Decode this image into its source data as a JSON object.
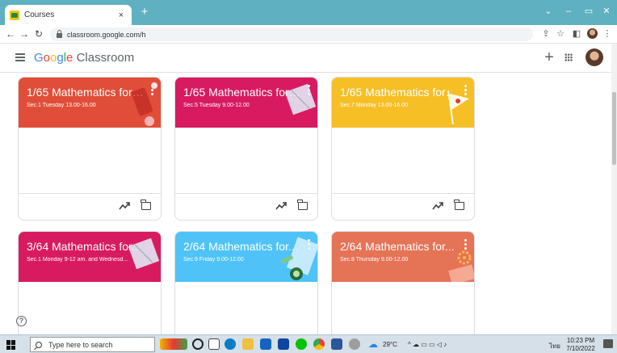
{
  "browser": {
    "tab_title": "Courses",
    "tab_close": "×",
    "new_tab": "+",
    "url": "classroom.google.com/h",
    "window_controls": [
      "⌄",
      "–",
      "▭",
      "✕"
    ]
  },
  "app": {
    "logo_letters": [
      "G",
      "o",
      "o",
      "g",
      "l",
      "e"
    ],
    "logo_product": "Classroom",
    "add_label": "+"
  },
  "courses": [
    {
      "title": "1/65 Mathematics for ...",
      "section": "Sec.1 Tuesday 13.00-16.00",
      "color": "#e04e39"
    },
    {
      "title": "1/65 Mathematics for ...",
      "section": "Sec.5 Tuesday 9.00-12.00",
      "color": "#d81b60"
    },
    {
      "title": "1/65 Mathematics for ...",
      "section": "Sec.7 Monday 13.00-16.00",
      "color": "#f6bf26"
    },
    {
      "title": "3/64 Mathematics for...",
      "section": "Sec.1 Monday 9-12 am. and Wednesd...",
      "color": "#d81b60"
    },
    {
      "title": "2/64 Mathematics for...",
      "section": "Sec.9 Friday 9.00-12.00",
      "color": "#4fc3f7"
    },
    {
      "title": "2/64 Mathematics for...",
      "section": "Sec.8 Thursday 9.00-12.00",
      "color": "#e57356"
    }
  ],
  "help_label": "?",
  "taskbar": {
    "search_placeholder": "Type here to search",
    "weather": "29°C",
    "language": "ไทย",
    "time": "10:23 PM",
    "date": "7/10/2022"
  },
  "icons": {
    "trend": "trending-up-icon",
    "folder": "folder-icon",
    "more": "more-vert-icon"
  }
}
